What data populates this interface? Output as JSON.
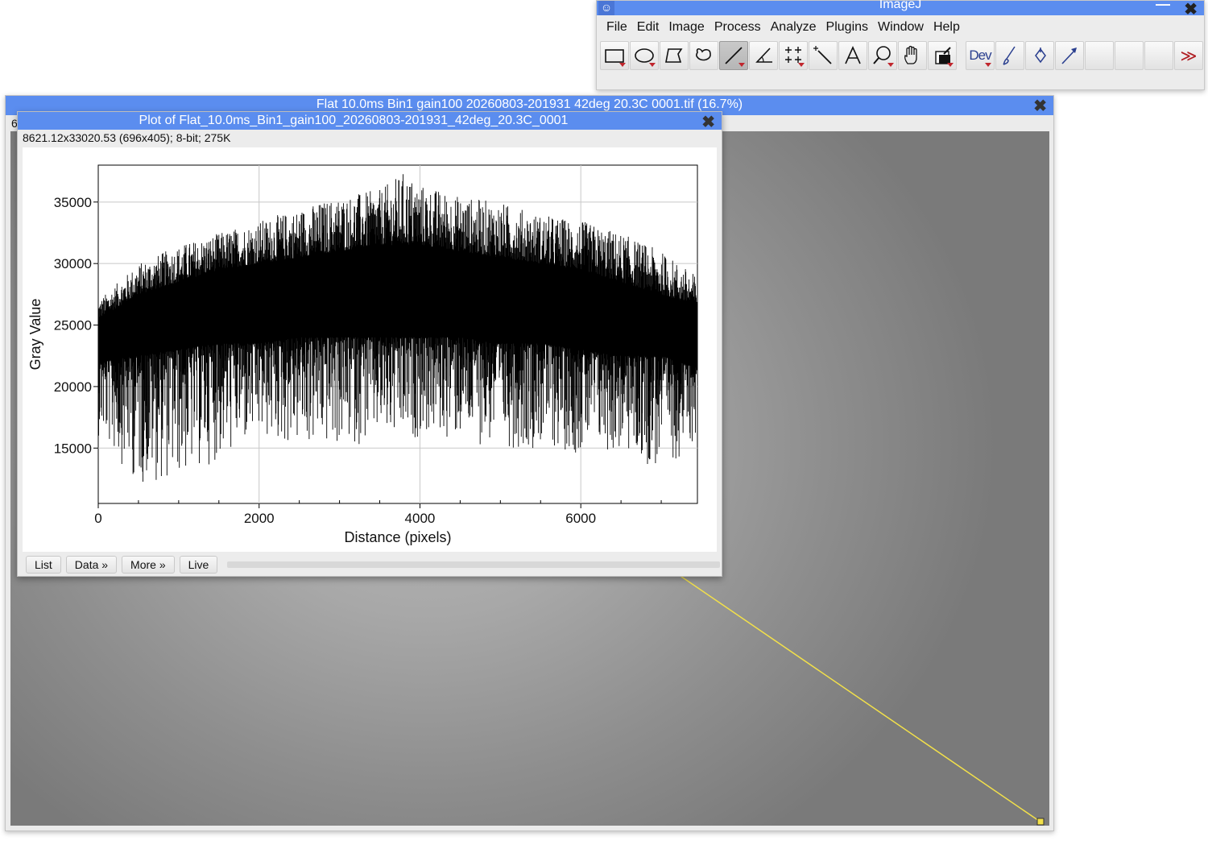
{
  "imagej": {
    "title": "ImageJ",
    "minimize": "—",
    "close": "✖",
    "menus": [
      "File",
      "Edit",
      "Image",
      "Process",
      "Analyze",
      "Plugins",
      "Window",
      "Help"
    ],
    "tools": {
      "dev_label": "Dev",
      "more_label": "≫"
    }
  },
  "image_window": {
    "title": "Flat  10.0ms  Bin1  gain100  20260803-201931  42deg  20.3C  0001.tif (16.7%)",
    "close": "✖",
    "side_label": "6"
  },
  "plot_window": {
    "title": "Plot of Flat_10.0ms_Bin1_gain100_20260803-201931_42deg_20.3C_0001",
    "close": "✖",
    "info": "8621.12x33020.53   (696x405); 8-bit; 275K",
    "buttons": {
      "list": "List",
      "data": "Data »",
      "more": "More »",
      "live": "Live"
    }
  },
  "chart_data": {
    "type": "line",
    "title": "",
    "xlabel": "Distance (pixels)",
    "ylabel": "Gray Value",
    "xlim": [
      0,
      7450
    ],
    "ylim": [
      10500,
      38000
    ],
    "x_ticks": [
      0,
      2000,
      4000,
      6000
    ],
    "y_ticks": [
      15000,
      20000,
      25000,
      30000,
      35000
    ],
    "grid": true,
    "series": [
      {
        "envelope_x": [
          0,
          500,
          1000,
          1500,
          2000,
          2500,
          3000,
          3500,
          3800,
          4000,
          4500,
          5000,
          5500,
          6000,
          6500,
          7000,
          7450
        ],
        "upper": [
          27000,
          30000,
          31500,
          32500,
          33500,
          34500,
          35500,
          36000,
          37500,
          36500,
          35500,
          35000,
          34000,
          33500,
          32500,
          31000,
          29000
        ],
        "lower": [
          16000,
          12000,
          12500,
          14000,
          15500,
          15000,
          15000,
          15500,
          15000,
          16000,
          15500,
          15000,
          15000,
          14500,
          14500,
          13000,
          15500
        ],
        "band_upper": [
          25500,
          27500,
          28500,
          29500,
          30000,
          30500,
          31000,
          31500,
          31500,
          31500,
          31000,
          30500,
          30000,
          29500,
          28500,
          27500,
          26500
        ],
        "band_lower": [
          22000,
          22500,
          23000,
          23500,
          23500,
          24000,
          24000,
          24000,
          24000,
          24000,
          24000,
          23500,
          23500,
          23000,
          22500,
          22500,
          21500
        ]
      }
    ]
  }
}
